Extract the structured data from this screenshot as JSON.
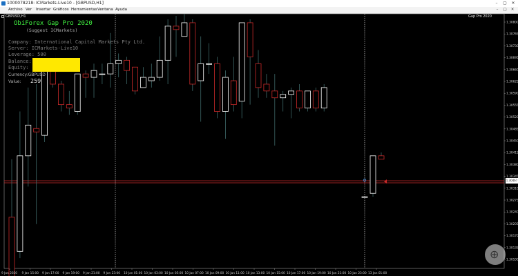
{
  "window": {
    "title": "1000078218: ICMarkets-Live10 - [GBPUSD,H1]",
    "controls": [
      "–",
      "▢",
      "✕"
    ]
  },
  "menu": {
    "items": [
      "Archivo",
      "Ver",
      "Insertar",
      "Gráficos",
      "Herramientas",
      "Ventana",
      "Ayuda"
    ],
    "mdi_controls": [
      "–",
      "▢",
      "✕"
    ]
  },
  "chart": {
    "symbol_label": "GBPUSD,H1",
    "indicator_name": "Gap Pro 2020",
    "bull_color": "#ffffff",
    "bear_color": "#cc2a2a",
    "current_price_tag": "1.30467"
  },
  "indicator": {
    "title": "ObiForex Gap Pro 2020",
    "subtitle": "(Suggest ICMarkets)",
    "company": "Company: International Capital Markets Pty Ltd.",
    "server": "Server: ICMarkets-Live10",
    "leverage": "Leverage: 500",
    "balance_label": "Balance:",
    "equity_label": "Equity:",
    "currency": "Currency:GBPUSD",
    "value_label": "Value:",
    "value": "259"
  },
  "chart_data": {
    "type": "candlestick",
    "price_ticks": [
      "1.30800",
      "1.30765",
      "1.30730",
      "1.30695",
      "1.30660",
      "1.30625",
      "1.30590",
      "1.30555",
      "1.30520",
      "1.30485",
      "1.30450",
      "1.30415",
      "1.30380",
      "1.30345",
      "1.30310",
      "1.30275",
      "1.30240",
      "1.30205",
      "1.30170",
      "1.30135",
      "1.30100"
    ],
    "date_ticks": [
      "9 Jan 2020",
      "9 Jan 15:00",
      "9 Jan 17:00",
      "9 Jan 19:00",
      "9 Jan 21:00",
      "9 Jan 23:00",
      "10 Jan 01:00",
      "10 Jan 03:00",
      "10 Jan 05:00",
      "10 Jan 07:00",
      "10 Jan 09:00",
      "10 Jan 11:00",
      "10 Jan 13:00",
      "10 Jan 15:00",
      "10 Jan 17:00",
      "10 Jan 19:00",
      "10 Jan 21:00",
      "10 Jan 23:00",
      "13 Jan 01:00"
    ],
    "session_separators": [
      "9 Jan 23:00",
      "13 Jan 00:00"
    ],
    "candles": [
      {
        "o": 1.3025,
        "h": 1.3042,
        "l": 1.3007,
        "c": 1.3007
      },
      {
        "o": 1.3015,
        "h": 1.3056,
        "l": 1.3013,
        "c": 1.3043
      },
      {
        "o": 1.3043,
        "h": 1.3063,
        "l": 1.3034,
        "c": 1.3052
      },
      {
        "o": 1.3051,
        "h": 1.3064,
        "l": 1.3023,
        "c": 1.305
      },
      {
        "o": 1.3049,
        "h": 1.307,
        "l": 1.3047,
        "c": 1.307
      },
      {
        "o": 1.307,
        "h": 1.307,
        "l": 1.3063,
        "c": 1.3064
      },
      {
        "o": 1.3064,
        "h": 1.3065,
        "l": 1.3056,
        "c": 1.3058
      },
      {
        "o": 1.3058,
        "h": 1.3062,
        "l": 1.3055,
        "c": 1.3057
      },
      {
        "o": 1.3056,
        "h": 1.3067,
        "l": 1.3055,
        "c": 1.3067
      },
      {
        "o": 1.3067,
        "h": 1.3068,
        "l": 1.306,
        "c": 1.3066
      },
      {
        "o": 1.3066,
        "h": 1.307,
        "l": 1.306,
        "c": 1.3068
      },
      {
        "o": 1.3067,
        "h": 1.307,
        "l": 1.3064,
        "c": 1.3067
      },
      {
        "o": 1.3067,
        "h": 1.3079,
        "l": 1.3063,
        "c": 1.307
      },
      {
        "o": 1.307,
        "h": 1.3073,
        "l": 1.3066,
        "c": 1.3071
      },
      {
        "o": 1.3071,
        "h": 1.3072,
        "l": 1.3064,
        "c": 1.3068
      },
      {
        "o": 1.3069,
        "h": 1.3069,
        "l": 1.3061,
        "c": 1.3062
      },
      {
        "o": 1.3063,
        "h": 1.3069,
        "l": 1.3063,
        "c": 1.3066
      },
      {
        "o": 1.3065,
        "h": 1.307,
        "l": 1.3063,
        "c": 1.3066
      },
      {
        "o": 1.3066,
        "h": 1.3078,
        "l": 1.3065,
        "c": 1.3071
      },
      {
        "o": 1.3071,
        "h": 1.3083,
        "l": 1.3064,
        "c": 1.3081
      },
      {
        "o": 1.3081,
        "h": 1.3084,
        "l": 1.3072,
        "c": 1.308
      },
      {
        "o": 1.3078,
        "h": 1.3088,
        "l": 1.3078,
        "c": 1.3082
      },
      {
        "o": 1.3082,
        "h": 1.3083,
        "l": 1.3062,
        "c": 1.3064
      },
      {
        "o": 1.3065,
        "h": 1.3078,
        "l": 1.3053,
        "c": 1.307
      },
      {
        "o": 1.307,
        "h": 1.3076,
        "l": 1.3067,
        "c": 1.307
      },
      {
        "o": 1.307,
        "h": 1.3072,
        "l": 1.3054,
        "c": 1.3056
      },
      {
        "o": 1.3056,
        "h": 1.3068,
        "l": 1.3048,
        "c": 1.3066
      },
      {
        "o": 1.3065,
        "h": 1.3072,
        "l": 1.3056,
        "c": 1.3058
      },
      {
        "o": 1.3059,
        "h": 1.3082,
        "l": 1.3054,
        "c": 1.3082
      },
      {
        "o": 1.3082,
        "h": 1.3083,
        "l": 1.3058,
        "c": 1.3072
      },
      {
        "o": 1.307,
        "h": 1.3074,
        "l": 1.306,
        "c": 1.3063
      },
      {
        "o": 1.3064,
        "h": 1.3067,
        "l": 1.306,
        "c": 1.3062
      },
      {
        "o": 1.3062,
        "h": 1.3067,
        "l": 1.3046,
        "c": 1.306
      },
      {
        "o": 1.306,
        "h": 1.3062,
        "l": 1.3056,
        "c": 1.3061
      },
      {
        "o": 1.3061,
        "h": 1.3063,
        "l": 1.3054,
        "c": 1.3062
      },
      {
        "o": 1.3062,
        "h": 1.3064,
        "l": 1.3056,
        "c": 1.3057
      },
      {
        "o": 1.3057,
        "h": 1.3062,
        "l": 1.3056,
        "c": 1.3062
      },
      {
        "o": 1.3062,
        "h": 1.3063,
        "l": 1.3056,
        "c": 1.3057
      },
      {
        "o": 1.3057,
        "h": 1.3064,
        "l": 1.3056,
        "c": 1.3063
      },
      {
        "o": 1.3031,
        "h": 1.3031,
        "l": 1.3031,
        "c": 1.3031
      },
      {
        "o": 1.3032,
        "h": 1.3043,
        "l": 1.3031,
        "c": 1.3043
      },
      {
        "o": 1.3043,
        "h": 1.3044,
        "l": 1.3042,
        "c": 1.3042
      }
    ]
  }
}
